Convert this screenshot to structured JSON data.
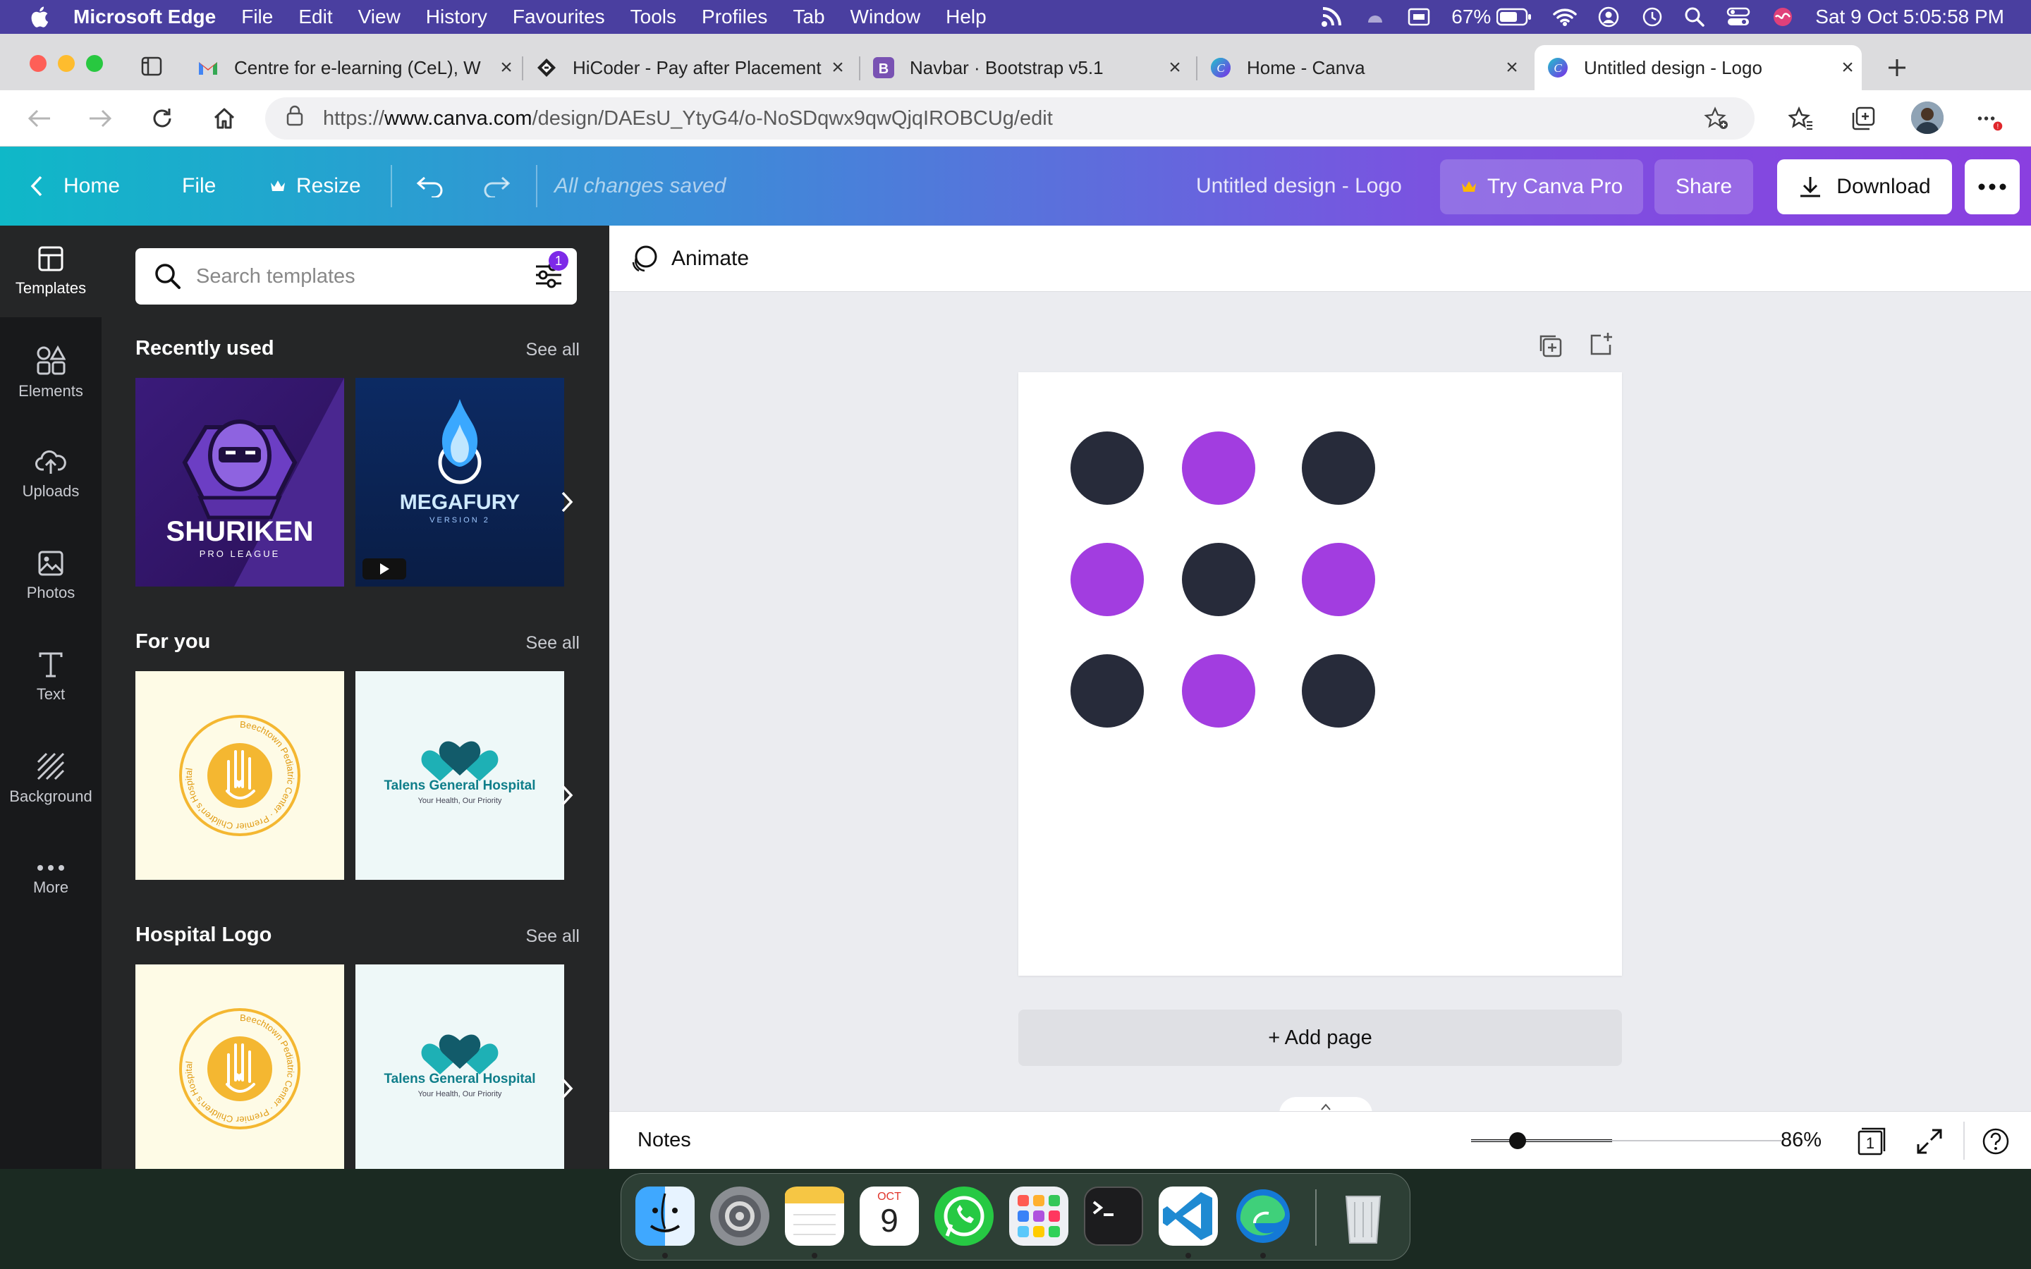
{
  "menubar": {
    "app": "Microsoft Edge",
    "items": [
      "File",
      "Edit",
      "View",
      "History",
      "Favourites",
      "Tools",
      "Profiles",
      "Tab",
      "Window",
      "Help"
    ],
    "battery": "67%",
    "datetime": "Sat 9 Oct  5:05:58 PM"
  },
  "tabs": [
    {
      "title": "Centre for e-learning (CeL), W",
      "favicon": "gmail-icon"
    },
    {
      "title": "HiCoder - Pay after Placement",
      "favicon": "hicoder-icon"
    },
    {
      "title": "Navbar · Bootstrap v5.1",
      "favicon": "bootstrap-icon"
    },
    {
      "title": "Home - Canva",
      "favicon": "canva-icon"
    },
    {
      "title": "Untitled design - Logo",
      "favicon": "canva-icon"
    }
  ],
  "address": {
    "prefix": "https://",
    "domain": "www.canva.com",
    "path": "/design/DAEsU_YtyG4/o-NoSDqwx9qwQjqIROBCUg/edit"
  },
  "canva": {
    "home": "Home",
    "file": "File",
    "resize": "Resize",
    "saved": "All changes saved",
    "design_title": "Untitled design - Logo",
    "try_pro": "Try Canva Pro",
    "share": "Share",
    "download": "Download",
    "gradient_start": "#0fb8c8",
    "gradient_end": "#8a3fe0"
  },
  "rail": [
    {
      "label": "Templates",
      "icon": "templates-icon",
      "active": true
    },
    {
      "label": "Elements",
      "icon": "elements-icon"
    },
    {
      "label": "Uploads",
      "icon": "uploads-icon"
    },
    {
      "label": "Photos",
      "icon": "photos-icon"
    },
    {
      "label": "Text",
      "icon": "text-icon"
    },
    {
      "label": "Background",
      "icon": "background-icon"
    },
    {
      "label": "More",
      "icon": "more-icon"
    }
  ],
  "panel": {
    "search_placeholder": "Search templates",
    "filter_badge": "1",
    "sections": [
      {
        "title": "Recently used",
        "see_all": "See all",
        "thumbs": [
          {
            "name": "SHURIKEN",
            "sub": "PRO LEAGUE"
          },
          {
            "name": "MEGAFURY",
            "sub": "VERSION 2"
          }
        ]
      },
      {
        "title": "For you",
        "see_all": "See all",
        "thumbs": [
          {
            "ring": "Beechtown Pediatric Center · Premier Children's Hospital"
          },
          {
            "name": "Talens General Hospital",
            "sub": "Your Health, Our Priority"
          }
        ]
      },
      {
        "title": "Hospital Logo",
        "see_all": "See all",
        "thumbs": [
          {
            "ring": "Beechtown Pediatric Center · Premier Children's Hospital"
          },
          {
            "name": "Talens General Hospital",
            "sub": "Your Health, Our Priority"
          }
        ]
      }
    ]
  },
  "editor": {
    "animate": "Animate",
    "add_page": "+ Add page",
    "notes": "Notes",
    "zoom": "86%",
    "zoom_level": 0.15,
    "page_count": "1",
    "dots": [
      "dark",
      "purple",
      "dark",
      "purple",
      "dark",
      "purple",
      "dark",
      "purple",
      "dark"
    ],
    "dark_color": "#272b3a",
    "purple_color": "#a23de0"
  },
  "dock": {
    "apps": [
      "finder-icon",
      "system-preferences-icon",
      "notes-icon",
      "calendar-icon",
      "whatsapp-icon",
      "launchpad-icon",
      "terminal-icon",
      "vscode-icon",
      "edge-icon",
      "trash-icon"
    ],
    "calendar_month": "OCT",
    "calendar_day": "9"
  }
}
